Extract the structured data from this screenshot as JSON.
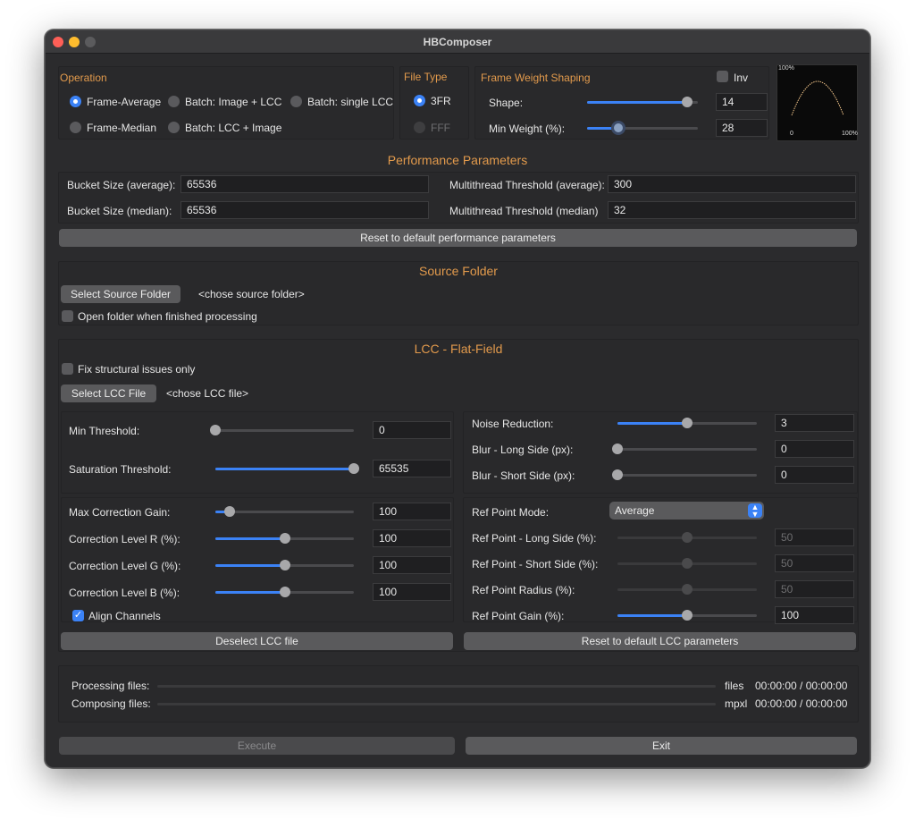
{
  "window": {
    "title": "HBComposer"
  },
  "operation": {
    "title": "Operation",
    "options": [
      "Frame-Average",
      "Batch: Image + LCC",
      "Batch: single LCC",
      "Frame-Median",
      "Batch: LCC + Image"
    ],
    "selected": "Frame-Average"
  },
  "file_type": {
    "title": "File Type",
    "options": [
      "3FR",
      "FFF"
    ],
    "selected": "3FR"
  },
  "frame_weight": {
    "title": "Frame Weight Shaping",
    "inv_label": "Inv",
    "inv_checked": false,
    "shape_label": "Shape:",
    "shape_value": "14",
    "shape_level": 0.9,
    "min_weight_label": "Min Weight (%):",
    "min_weight_value": "28",
    "min_weight_level": 0.28,
    "preview": {
      "y_top_label": "100%",
      "x_left_label": "0",
      "x_right_label": "100%"
    }
  },
  "performance": {
    "title": "Performance Parameters",
    "bucket_avg_label": "Bucket Size (average):",
    "bucket_avg_value": "65536",
    "bucket_med_label": "Bucket Size (median):",
    "bucket_med_value": "65536",
    "mt_avg_label": "Multithread Threshold (average):",
    "mt_avg_value": "300",
    "mt_med_label": "Multithread Threshold (median)",
    "mt_med_value": "32",
    "reset_label": "Reset to default performance parameters"
  },
  "source": {
    "title": "Source Folder",
    "select_label": "Select Source Folder",
    "path_placeholder": "<chose source folder>",
    "open_when_finished_label": "Open folder when finished processing",
    "open_when_finished_checked": false
  },
  "lcc": {
    "title": "LCC - Flat-Field",
    "fix_structural_label": "Fix structural issues only",
    "fix_structural_checked": false,
    "select_label": "Select LCC File",
    "path_placeholder": "<chose LCC file>",
    "min_threshold_label": "Min Threshold:",
    "min_threshold_value": "0",
    "min_threshold_level": 0,
    "saturation_label": "Saturation Threshold:",
    "saturation_value": "65535",
    "saturation_level": 1,
    "max_gain_label": "Max Correction Gain:",
    "max_gain_value": "100",
    "max_gain_level": 0.1,
    "level_r_label": "Correction Level R (%):",
    "level_r_value": "100",
    "level_r_level": 0.5,
    "level_g_label": "Correction Level G (%):",
    "level_g_value": "100",
    "level_g_level": 0.5,
    "level_b_label": "Correction Level B (%):",
    "level_b_value": "100",
    "level_b_level": 0.5,
    "align_label": "Align Channels",
    "align_checked": true,
    "noise_label": "Noise Reduction:",
    "noise_value": "3",
    "noise_level": 0.5,
    "blur_long_label": "Blur - Long Side (px):",
    "blur_long_value": "0",
    "blur_long_level": 0,
    "blur_short_label": "Blur - Short Side (px):",
    "blur_short_value": "0",
    "blur_short_level": 0,
    "ref_mode_label": "Ref Point Mode:",
    "ref_mode_value": "Average",
    "ref_long_label": "Ref Point - Long Side (%):",
    "ref_long_value": "50",
    "ref_short_label": "Ref Point - Short Side (%):",
    "ref_short_value": "50",
    "ref_radius_label": "Ref Point Radius (%):",
    "ref_radius_value": "50",
    "ref_gain_label": "Ref Point Gain (%):",
    "ref_gain_value": "100",
    "ref_gain_level": 0.5,
    "deselect_label": "Deselect LCC file",
    "reset_label": "Reset to default LCC parameters"
  },
  "progress": {
    "processing_label": "Processing files:",
    "processing_unit": "files",
    "processing_time": "00:00:00 / 00:00:00",
    "composing_label": "Composing files:",
    "composing_unit": "mpxl",
    "composing_time": "00:00:00 / 00:00:00"
  },
  "actions": {
    "execute_label": "Execute",
    "exit_label": "Exit"
  }
}
